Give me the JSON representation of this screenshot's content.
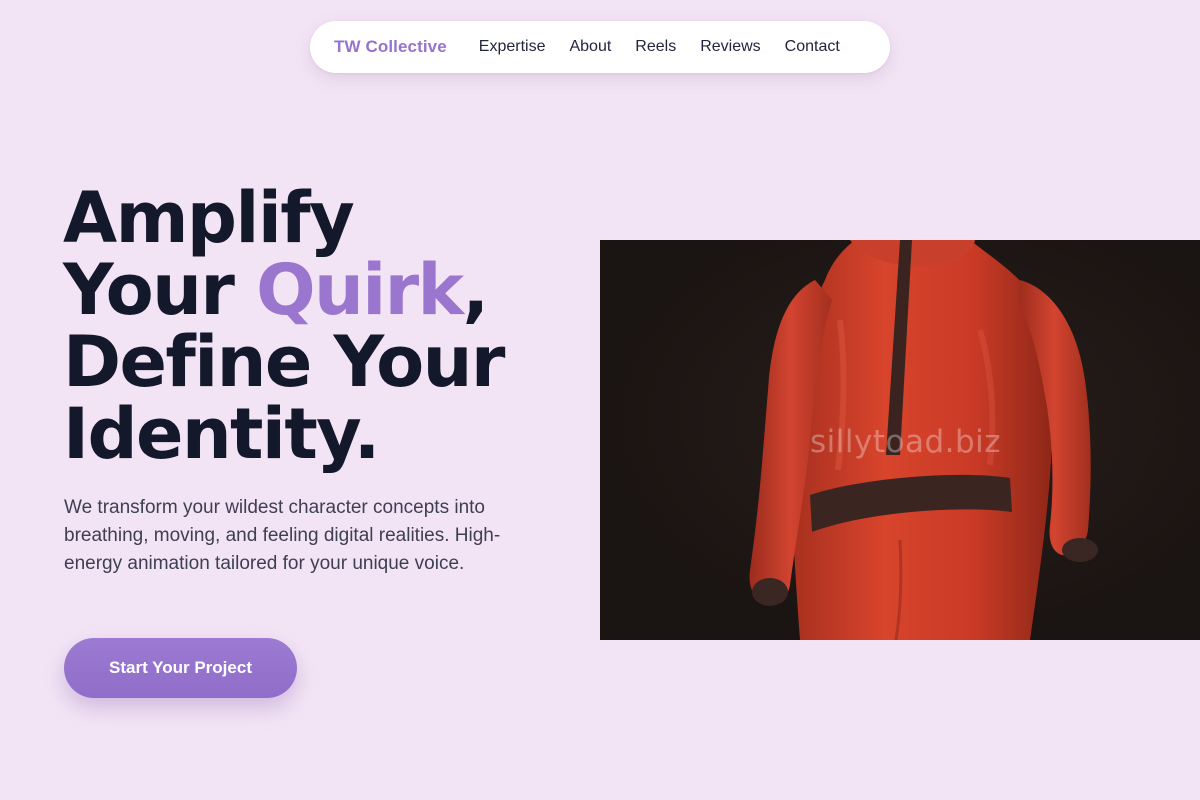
{
  "nav": {
    "brand": "TW Collective",
    "links": [
      {
        "label": "Expertise"
      },
      {
        "label": "About"
      },
      {
        "label": "Reels"
      },
      {
        "label": "Reviews"
      },
      {
        "label": "Contact"
      }
    ]
  },
  "hero": {
    "title_line1": "Amplify",
    "title_line2_pre": "Your ",
    "title_line2_accent": "Quirk",
    "title_line2_post": ",",
    "title_line3": "Define Your",
    "title_line4": "Identity.",
    "description": "We transform your wildest character concepts into breathing, moving, and feeling digital realities. High-energy animation tailored for your unique voice.",
    "cta_label": "Start Your Project",
    "image_watermark": "sillytoad.biz",
    "image_subject": "red-character-figure"
  },
  "colors": {
    "background": "#f3e4f5",
    "accent": "#9a76cf",
    "heading": "#14182b",
    "body_text": "#3d4052"
  }
}
